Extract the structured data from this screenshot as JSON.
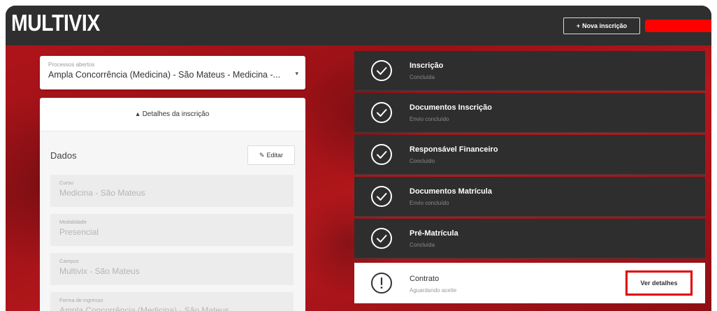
{
  "header": {
    "logo": "MULTIVIX",
    "new_enrollment_label": "Nova inscrição",
    "plus_glyph": "+"
  },
  "process": {
    "label": "Processos abertos",
    "value": "Ampla Concorrência (Medicina) - São Mateus - Medicina -...",
    "caret_glyph": "▾"
  },
  "details": {
    "header_label": "Detalhes da inscrição",
    "header_glyph": "▴",
    "section_title": "Dados",
    "edit_label": "Editar",
    "edit_glyph": "✎",
    "fields": [
      {
        "label": "Curso",
        "value": "Medicina - São Mateus"
      },
      {
        "label": "Modalidade",
        "value": "Presencial"
      },
      {
        "label": "Campus",
        "value": "Multivix - São Mateus"
      },
      {
        "label": "Forma de ingresso",
        "value": "Ampla Concorrência (Medicina) - São Mateus"
      }
    ]
  },
  "steps": [
    {
      "title": "Inscrição",
      "status": "Concluída",
      "icon": "check-circle-icon"
    },
    {
      "title": "Documentos Inscrição",
      "status": "Envio concluído",
      "icon": "check-circle-icon"
    },
    {
      "title": "Responsável Financeiro",
      "status": "Concluído",
      "icon": "check-circle-icon"
    },
    {
      "title": "Documentos Matrícula",
      "status": "Envio concluído",
      "icon": "check-circle-icon"
    },
    {
      "title": "Pré-Matrícula",
      "status": "Concluída",
      "icon": "check-circle-icon"
    },
    {
      "title": "Contrato",
      "status": "Aguardando aceite",
      "icon": "alert-circle-icon",
      "action_label": "Ver detalhes"
    }
  ],
  "colors": {
    "brand_red": "#b3151b",
    "topbar": "#2f2f2f",
    "step_dark": "#2e2e2e",
    "highlight": "#e00000"
  }
}
